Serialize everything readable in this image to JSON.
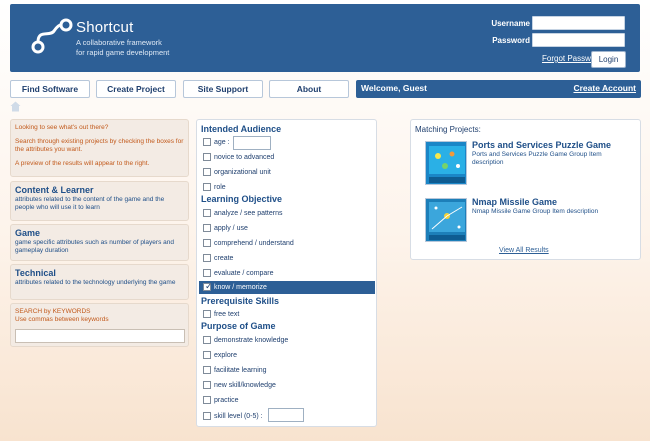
{
  "header": {
    "brand_name": "Shortcut",
    "tagline_line1": "A collaborative framework",
    "tagline_line2": "for rapid game development",
    "username_label": "Username",
    "password_label": "Password",
    "forgot_password": "Forgot Password",
    "login_button": "Login"
  },
  "nav": {
    "find_software": "Find Software",
    "create_project": "Create Project",
    "site_support": "Site Support",
    "about": "About"
  },
  "account_bar": {
    "welcome": "Welcome, Guest",
    "create_account": "Create Account"
  },
  "sidebar": {
    "intro_heading": "Looking to see what's out there?",
    "intro_body": "Search through existing projects by checking the boxes for the attributes you want.",
    "intro_preview": "A preview of the results will appear to the right.",
    "categories": [
      {
        "title": "Content & Learner",
        "desc": "attributes related to the content of the game and the people who will use it to learn"
      },
      {
        "title": "Game",
        "desc": "game specific attributes such as number of players and gameplay duration"
      },
      {
        "title": "Technical",
        "desc": "attributes related to the technology underlying the game"
      }
    ],
    "keyword_heading": "SEARCH by KEYWORDS",
    "keyword_hint": "Use commas between keywords"
  },
  "filters": {
    "intended_audience": {
      "title": "Intended Audience",
      "options": [
        "age :",
        "novice to advanced",
        "organizational unit",
        "role"
      ]
    },
    "learning_objective": {
      "title": "Learning Objective",
      "options": [
        "analyze / see patterns",
        "apply / use",
        "comprehend / understand",
        "create",
        "evaluate / compare",
        "know / memorize"
      ],
      "checked": "know / memorize"
    },
    "prerequisite_skills": {
      "title": "Prerequisite Skills",
      "options": [
        "free text"
      ]
    },
    "purpose_of_game": {
      "title": "Purpose of Game",
      "options": [
        "demonstrate knowledge",
        "explore",
        "facilitate learning",
        "new skill/knowledge",
        "practice",
        "skill level (0-5) :"
      ]
    }
  },
  "results": {
    "title": "Matching Projects:",
    "projects": [
      {
        "name": "Ports and Services Puzzle Game",
        "desc": "Ports and Services Puzzle Game Group Item description"
      },
      {
        "name": "Nmap Missile Game",
        "desc": "Nmap Missile Game Group Item description"
      }
    ],
    "view_all": "View All Results"
  },
  "colors": {
    "primary": "#2d5f96",
    "accent_orange": "#c25a1c",
    "link_blue": "#1f4f88"
  }
}
